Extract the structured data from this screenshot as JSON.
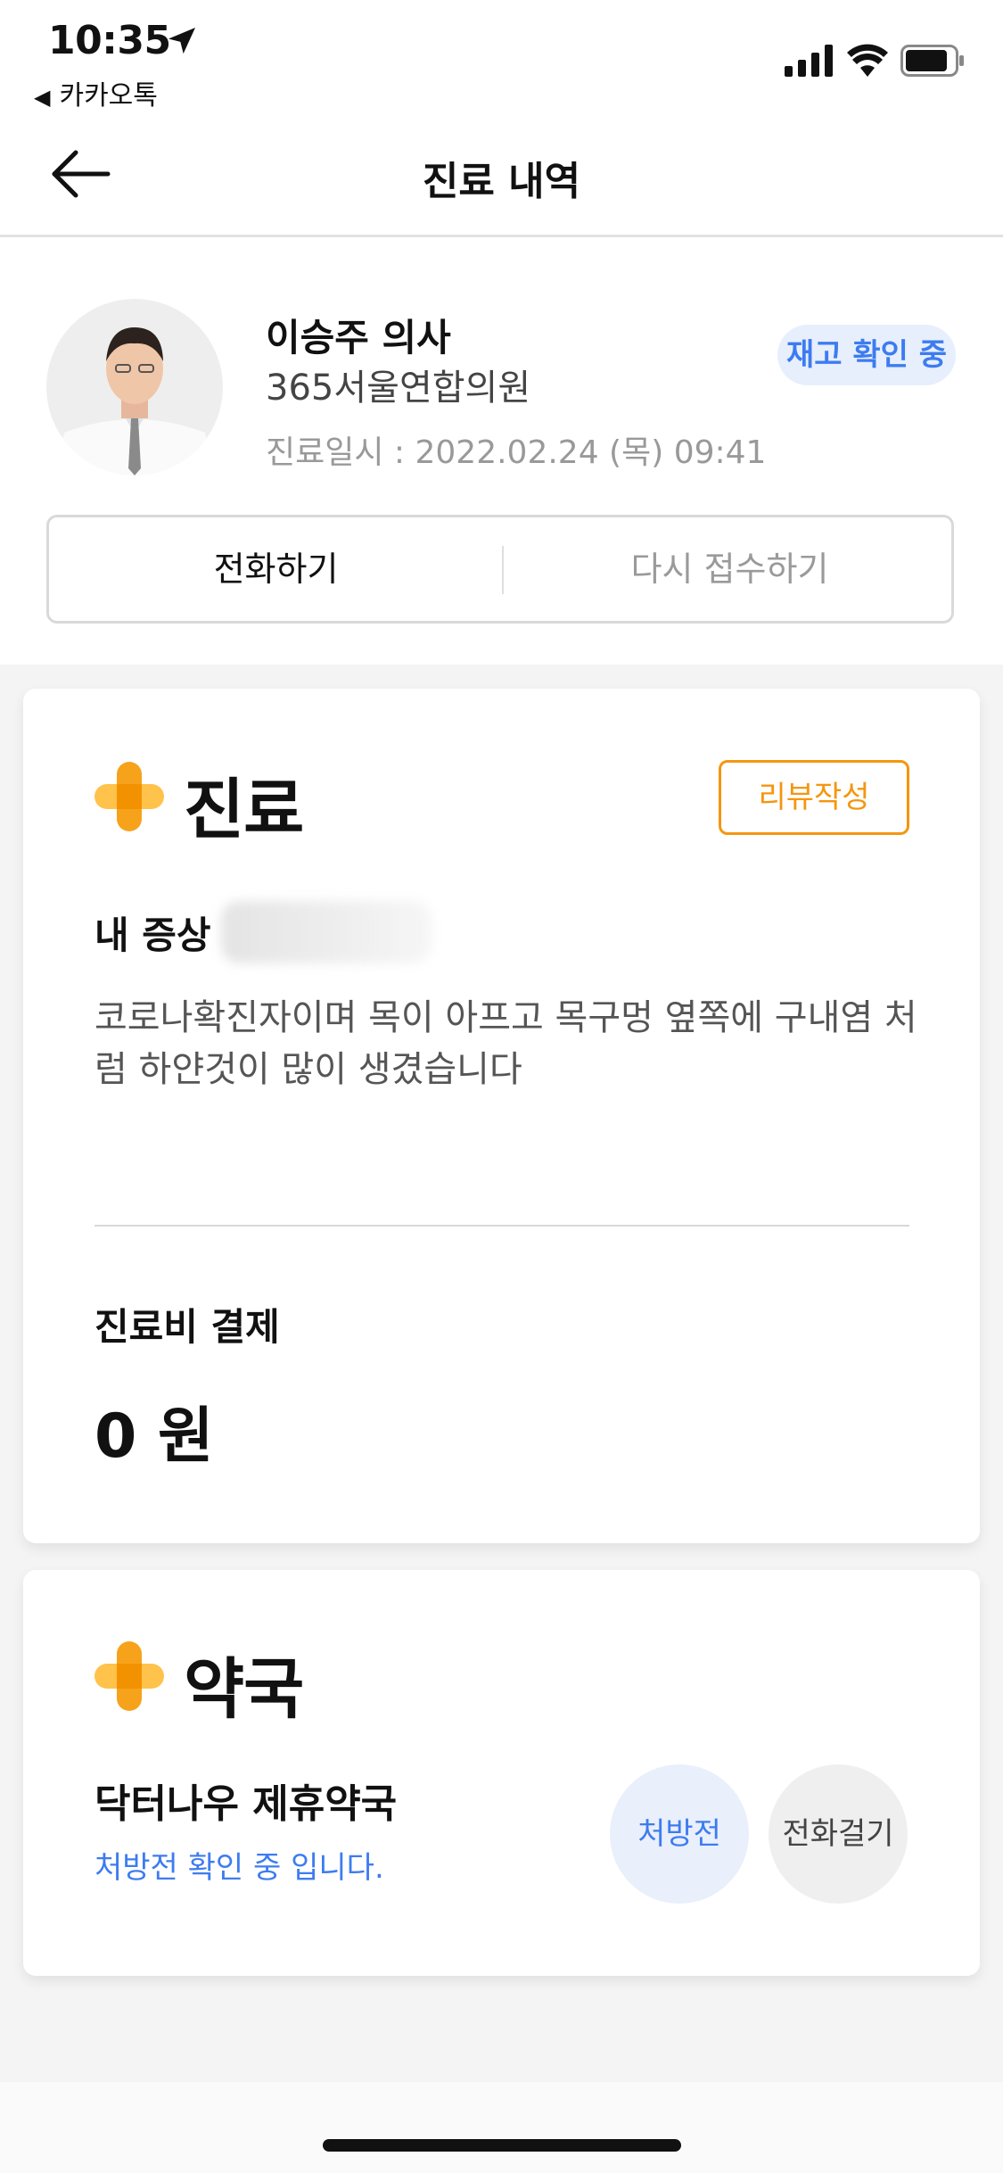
{
  "status_bar": {
    "time": "10:35",
    "back_app_label": "카카오톡"
  },
  "nav": {
    "title": "진료 내역"
  },
  "doctor": {
    "name": "이승주 의사",
    "clinic": "365서울연합의원",
    "visit_datetime": "진료일시 : 2022.02.24 (목) 09:41",
    "status_badge": "재고 확인 중"
  },
  "actions": {
    "call_label": "전화하기",
    "reapply_label": "다시 접수하기"
  },
  "consultation_card": {
    "title": "진료",
    "review_button": "리뷰작성",
    "symptom_label": "내 증상",
    "symptom_text": "코로나확진자이며 목이 아프고 목구멍 옆쪽에 구내염 처럼 하얀것이 많이 생겼습니다",
    "fee_label": "진료비 결제",
    "fee_value": "0 원"
  },
  "pharmacy_card": {
    "title": "약국",
    "pharmacy_name": "닥터나우 제휴약국",
    "status_text": "처방전 확인 중 입니다.",
    "prescription_button": "처방전",
    "call_button": "전화걸기"
  },
  "colors": {
    "accent_blue": "#3d7cf0",
    "accent_orange": "#f5960f",
    "badge_bg": "#e7effc"
  },
  "icons": [
    "location-arrow-icon",
    "signal-icon",
    "wifi-icon",
    "battery-icon",
    "back-arrow-icon",
    "medical-cross-icon"
  ]
}
